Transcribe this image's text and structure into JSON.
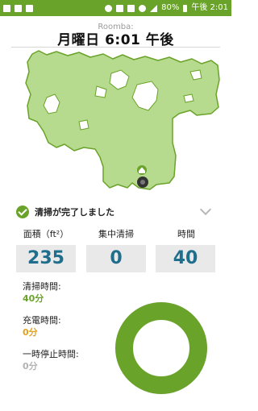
{
  "status_bar": {
    "battery": "80%",
    "time": "午後 2:01"
  },
  "header": {
    "device_name": "Roomba:",
    "title": "月曜日 6:01 午後"
  },
  "map": {
    "icons": [
      "home-icon",
      "robot-icon"
    ],
    "colors": {
      "floor": "#b6da8e",
      "edge": "#6aa32a",
      "robot": "#333333"
    }
  },
  "summary": {
    "status": "清掃が完了しました",
    "stats": [
      {
        "label": "面積（ft²）",
        "value": "235"
      },
      {
        "label": "集中清掃",
        "value": "0"
      },
      {
        "label": "時間",
        "value": "40"
      }
    ],
    "metrics": [
      {
        "label": "清掃時間:",
        "value": "40分"
      },
      {
        "label": "充電時間:",
        "value": "0分"
      },
      {
        "label": "一時停止時間:",
        "value": "0分"
      }
    ],
    "donut": {
      "cleaning_fraction": 1.0,
      "color": "#6aa32a"
    }
  }
}
